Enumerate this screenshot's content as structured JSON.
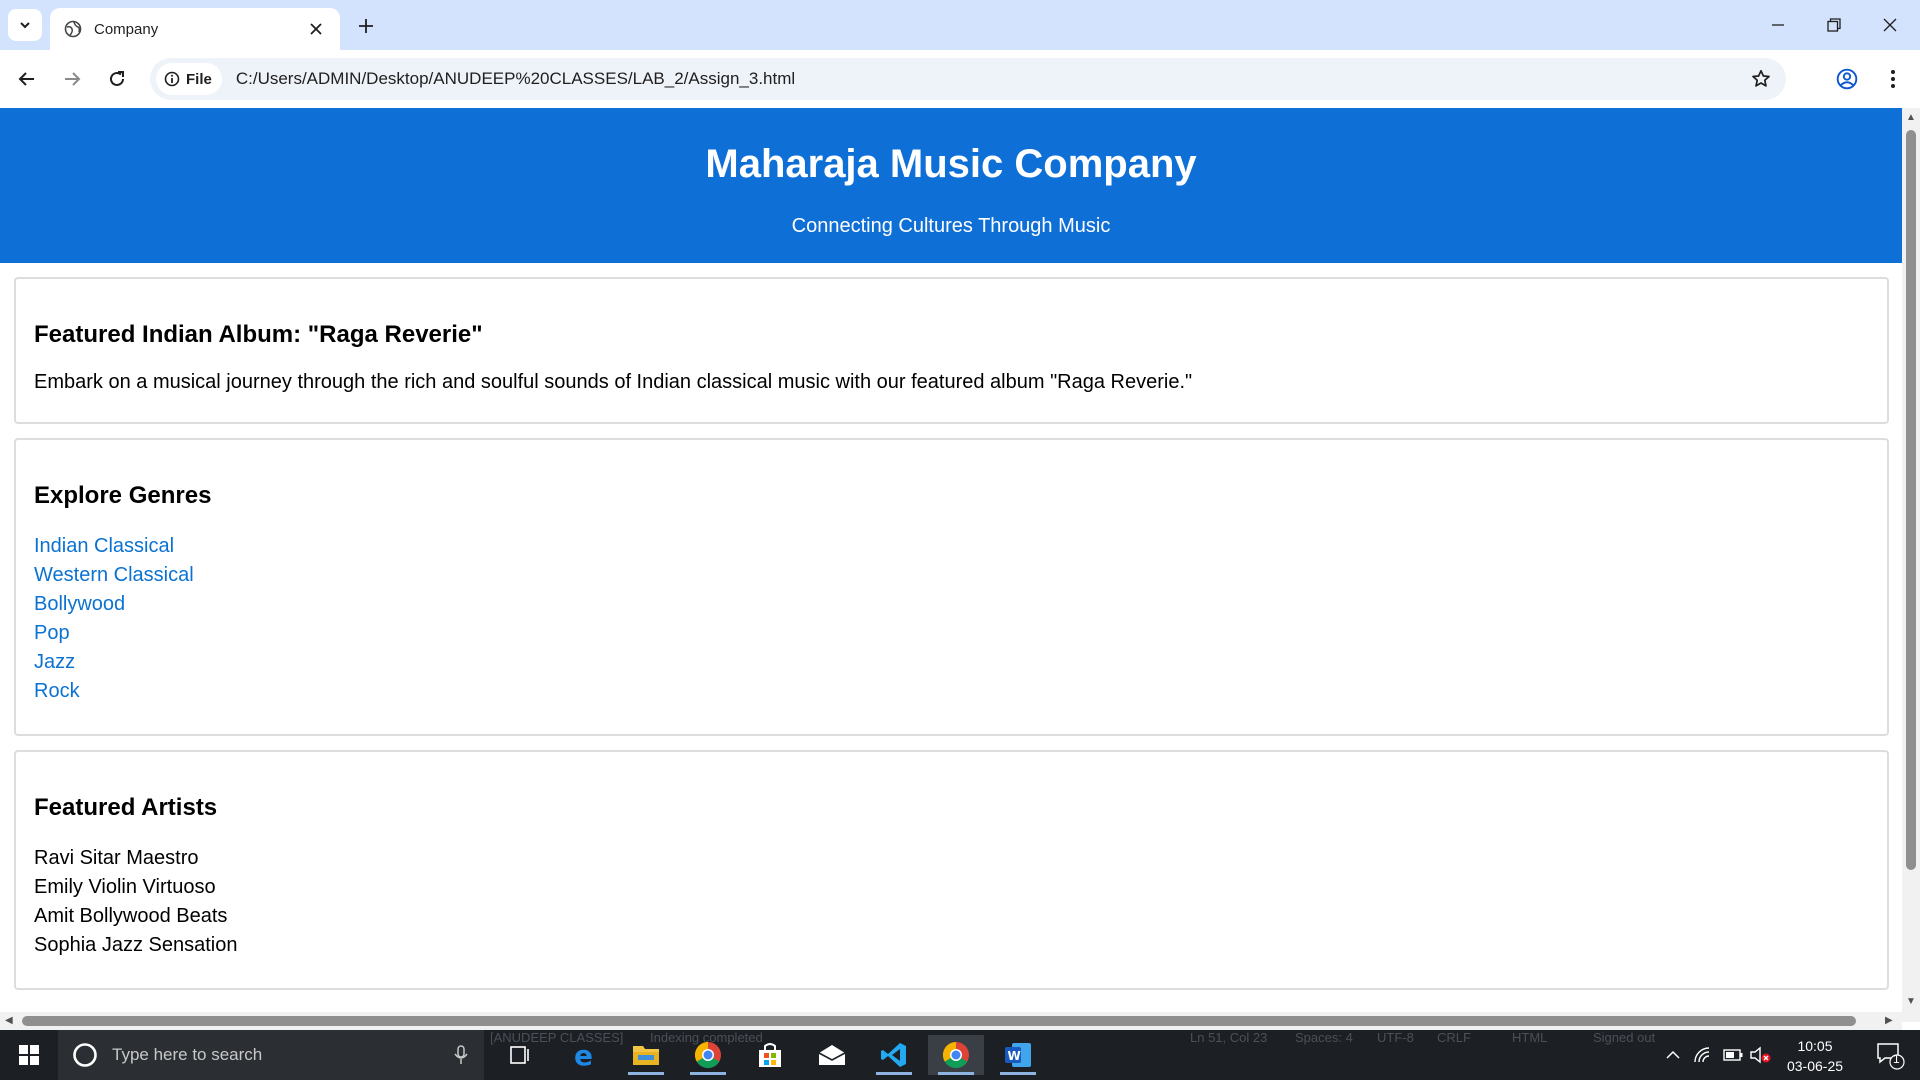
{
  "browser": {
    "tab_title": "Company",
    "site_chip_label": "File",
    "url": "C:/Users/ADMIN/Desktop/ANUDEEP%20CLASSES/LAB_2/Assign_3.html"
  },
  "page": {
    "header": {
      "title": "Maharaja Music Company",
      "tagline": "Connecting Cultures Through Music"
    },
    "featured_album": {
      "heading": "Featured Indian Album: \"Raga Reverie\"",
      "description": "Embark on a musical journey through the rich and soulful sounds of Indian classical music with our featured album \"Raga Reverie.\""
    },
    "genres": {
      "heading": "Explore Genres",
      "items": [
        "Indian Classical",
        "Western Classical",
        "Bollywood",
        "Pop",
        "Jazz",
        "Rock"
      ]
    },
    "artists": {
      "heading": "Featured Artists",
      "items": [
        "Ravi Sitar Maestro",
        "Emily Violin Virtuoso",
        "Amit Bollywood Beats",
        "Sophia Jazz Sensation"
      ]
    }
  },
  "taskbar": {
    "search_placeholder": "Type here to search",
    "time": "10:05",
    "date": "03-06-25",
    "notification_count": "1",
    "background_status": {
      "folder": "[ANUDEEP CLASSES]",
      "indexing": "Indexing completed",
      "cursor": "Ln 51, Col 23",
      "spaces": "Spaces: 4",
      "encoding": "UTF-8",
      "eol": "CRLF",
      "language": "HTML",
      "account": "Signed out"
    }
  },
  "colors": {
    "header_blue": "#0e6fd6",
    "link_blue": "#0b72d1",
    "tabstrip": "#d3e3fd",
    "taskbar": "#1c1f24"
  }
}
